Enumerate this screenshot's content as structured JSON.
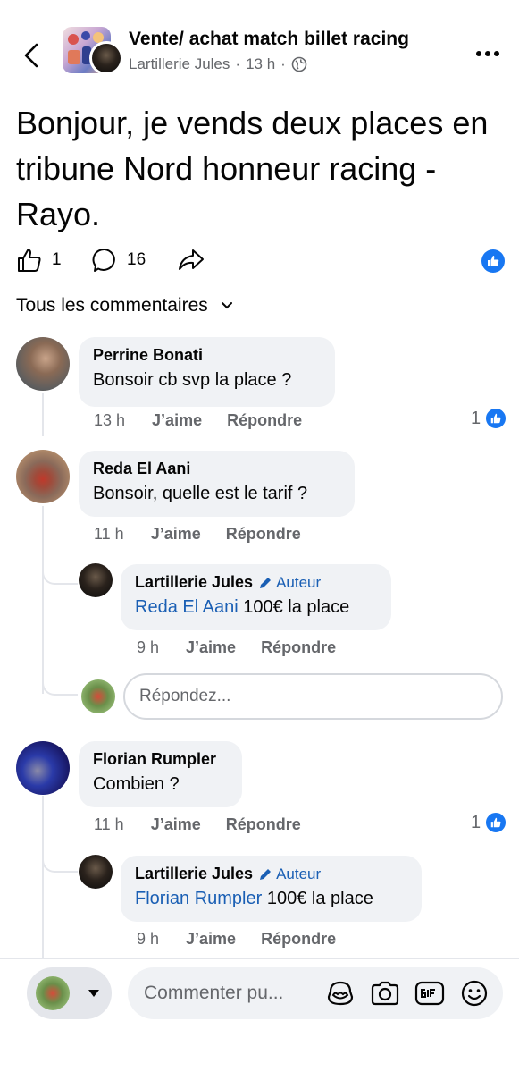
{
  "header": {
    "group_title": "Vente/ achat match billet racing",
    "author": "Lartillerie Jules",
    "sep1": "·",
    "time": "13 h",
    "sep2": "·"
  },
  "post": {
    "text": "Bonjour, je vends deux places en tribune Nord honneur racing - Rayo.",
    "like_count": "1",
    "comment_count": "16"
  },
  "sort_label": "Tous les commentaires",
  "comments": [
    {
      "name": "Perrine Bonati",
      "text": "Bonsoir cb svp la place ?",
      "time": "13 h",
      "like_label": "J’aime",
      "reply_label": "Répondre",
      "reactions": "1"
    },
    {
      "name": "Reda El Aani",
      "text": "Bonsoir, quelle est le tarif ?",
      "time": "11 h",
      "like_label": "J’aime",
      "reply_label": "Répondre",
      "reply": {
        "name": "Lartillerie Jules",
        "badge": "Auteur",
        "mention": "Reda El Aani",
        "text": "100€ la place",
        "time": "9 h",
        "like_label": "J’aime",
        "reply_label": "Répondre"
      }
    },
    {
      "name": "Florian Rumpler",
      "text": "Combien ?",
      "time": "11 h",
      "like_label": "J’aime",
      "reply_label": "Répondre",
      "reactions": "1",
      "reply": {
        "name": "Lartillerie Jules",
        "badge": "Auteur",
        "mention": "Florian Rumpler",
        "text": "100€ la place",
        "time": "9 h",
        "like_label": "J’aime",
        "reply_label": "Répondre"
      }
    }
  ],
  "reply_input_placeholder": "Répondez...",
  "composer_placeholder": "Commenter pu...",
  "colors": {
    "accent": "#1877f2",
    "mention": "#1a5fb4",
    "bubble": "#f0f2f5",
    "secondary_text": "#65676b"
  },
  "icons": [
    "back-arrow-icon",
    "globe-icon",
    "more-icon",
    "like-icon",
    "comment-icon",
    "share-icon",
    "thumbs-up-badge-icon",
    "chevron-down-icon",
    "pencil-icon",
    "avatar-sticker-icon",
    "camera-icon",
    "gif-icon",
    "emoji-icon",
    "caret-down-icon"
  ]
}
